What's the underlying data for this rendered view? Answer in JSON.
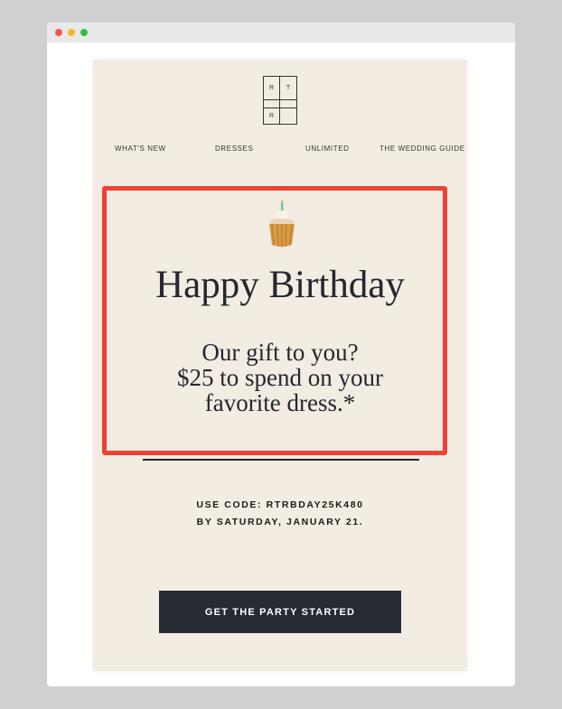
{
  "window": {
    "controls": [
      "close",
      "minimize",
      "maximize"
    ]
  },
  "email": {
    "logo": {
      "letters": [
        "R",
        "T",
        "",
        "",
        "R",
        ""
      ]
    },
    "nav": {
      "items": [
        {
          "label": "WHAT'S NEW"
        },
        {
          "label": "DRESSES"
        },
        {
          "label": "UNLIMITED"
        },
        {
          "label": "THE WEDDING GUIDE"
        }
      ]
    },
    "hero": {
      "icon": "cupcake-icon",
      "headline": "Happy Birthday",
      "subhead_lines": [
        "Our gift to you?",
        "$25 to spend on your",
        "favorite dress.*"
      ]
    },
    "code": {
      "line1": "USE CODE: RTRBDAY25K480",
      "line2": "BY SATURDAY, JANUARY 21."
    },
    "cta": {
      "label": "GET THE PARTY STARTED"
    }
  },
  "colors": {
    "page_background": "#d0d0d0",
    "email_background": "#f3ece2",
    "highlight_border": "#ee4236",
    "cta_background": "#262b33",
    "text": "#24272e"
  }
}
